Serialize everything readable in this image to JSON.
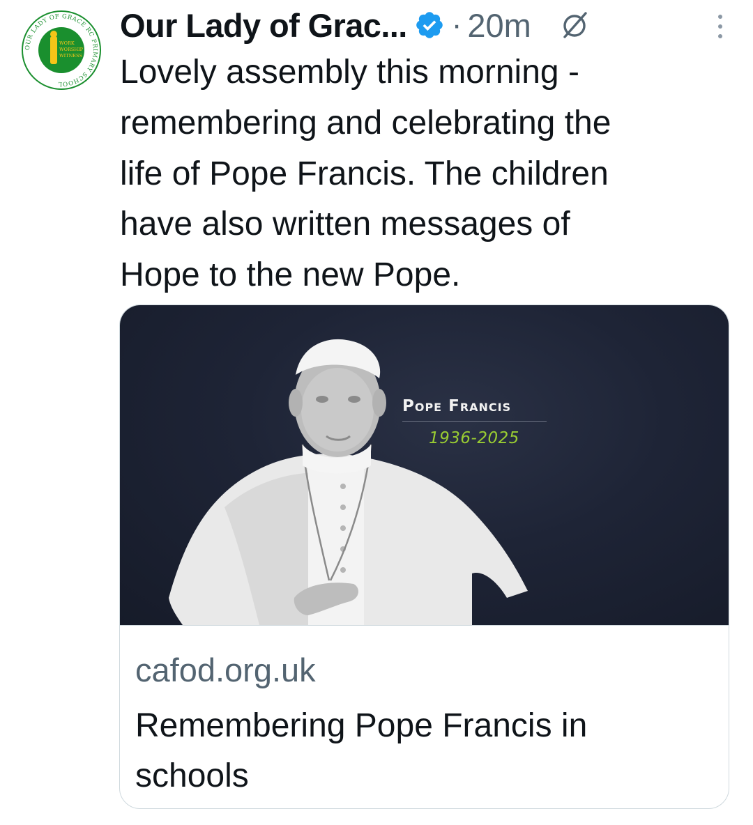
{
  "tweet": {
    "author": {
      "name": "Our Lady of Grac...",
      "verified": true,
      "avatar": {
        "ring_text": "OUR LADY OF GRACE RC PRIMARY SCHOOL",
        "motto": [
          "WORK",
          "WORSHIP",
          "WITNESS"
        ],
        "color": "#1a8f2e"
      }
    },
    "separator": "·",
    "time": "20m",
    "icons": {
      "grok": "grok-icon",
      "more": "more-vertical-icon"
    },
    "text": "Lovely assembly this morning -\nremembering and celebrating the\nlife of Pope Francis. The children\nhave also written messages of\nHope to the new Pope."
  },
  "card": {
    "image": {
      "overlay_title": "Pope Francis",
      "overlay_years": "1936-2025"
    },
    "domain": "cafod.org.uk",
    "title": "Remembering Pope Francis in schools"
  },
  "colors": {
    "text": "#0f1419",
    "muted": "#536471",
    "verified": "#1d9bf0",
    "border": "#cfd9de",
    "years_accent": "#9acd32",
    "card_bg": "#1e2436"
  }
}
